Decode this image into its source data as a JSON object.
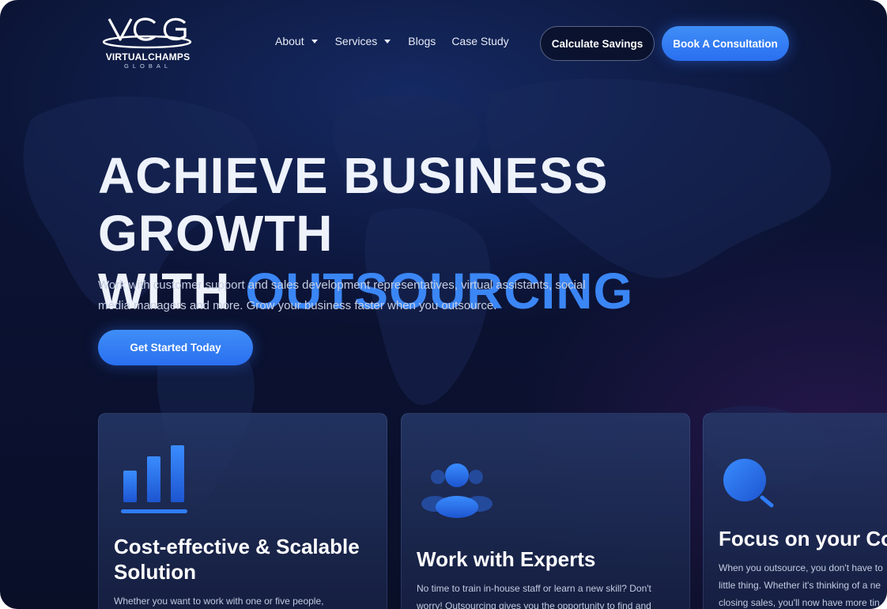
{
  "brand": {
    "logo_mark": "VCG",
    "name": "VIRTUALCHAMPS",
    "tagline": "GLOBAL"
  },
  "nav": {
    "items": [
      {
        "label": "About",
        "has_dropdown": true
      },
      {
        "label": "Services",
        "has_dropdown": true
      },
      {
        "label": "Blogs",
        "has_dropdown": false
      },
      {
        "label": "Case Study",
        "has_dropdown": false
      }
    ],
    "calculate_label": "Calculate Savings",
    "consult_label": "Book A Consultation"
  },
  "hero": {
    "title_line1": "ACHIEVE BUSINESS GROWTH",
    "title_line2_prefix": "WITH ",
    "title_line2_accent": "OUTSOURCING",
    "description": "Work with customer support and sales development representatives, virtual assistants, social media managers and more. Grow your business faster when you outsource.",
    "cta_label": "Get Started Today"
  },
  "cards": [
    {
      "icon": "bar-chart-icon",
      "title": "Cost-effective & Scalable Solution",
      "text": "Whether you want to work with one or five people,"
    },
    {
      "icon": "team-users-icon",
      "title": "Work with Experts",
      "text": "No time to train in-house staff or learn a new skill? Don't worry! Outsourcing gives you the opportunity to find and"
    },
    {
      "icon": "magnifier-icon",
      "title": "Focus on your Co",
      "text": "When you outsource, you don't have to little thing. Whether it's thinking of a ne closing sales, you'll now have more tin"
    }
  ],
  "colors": {
    "background": "#0a1230",
    "accent": "#3b86f5",
    "primary_button": "#2f78f2",
    "card": "#22325e"
  }
}
